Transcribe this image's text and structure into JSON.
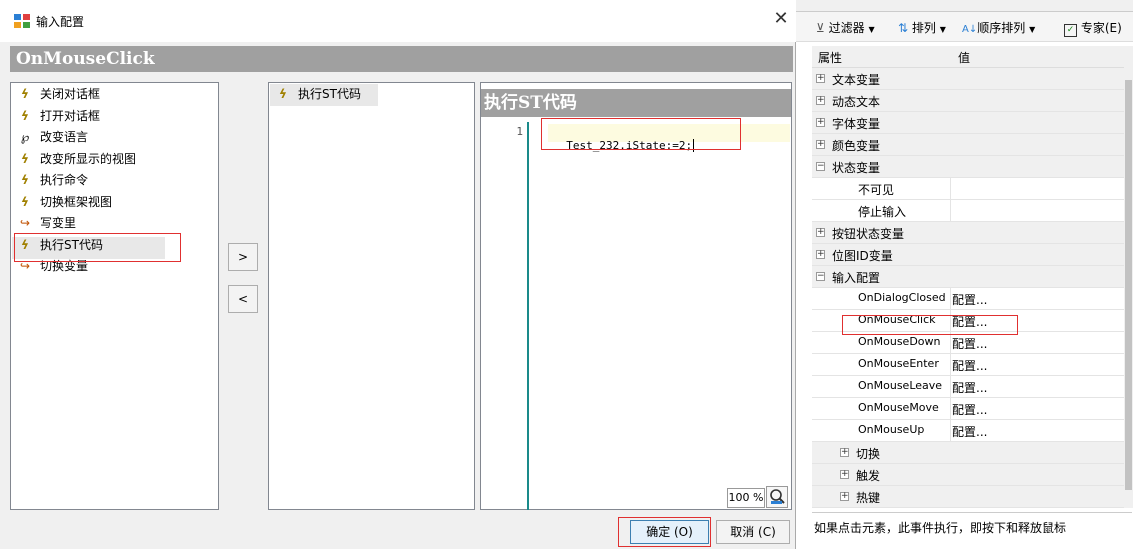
{
  "dialog": {
    "title": "输入配置",
    "close_glyph": "✕",
    "event_name": "OnMouseClick",
    "available_actions": [
      {
        "label": "关闭对话框",
        "icon": "bolt-icon"
      },
      {
        "label": "打开对话框",
        "icon": "bolt-icon"
      },
      {
        "label": "改变语言",
        "icon": "language-icon"
      },
      {
        "label": "改变所显示的视图",
        "icon": "bolt-icon"
      },
      {
        "label": "执行命令",
        "icon": "bolt-icon"
      },
      {
        "label": "切换框架视图",
        "icon": "bolt-icon"
      },
      {
        "label": "写变里",
        "icon": "write-variable-icon"
      },
      {
        "label": "执行ST代码",
        "icon": "bolt-icon"
      },
      {
        "label": "切换变量",
        "icon": "write-variable-icon"
      }
    ],
    "configured_actions": [
      {
        "label": "执行ST代码",
        "icon": "bolt-icon"
      }
    ],
    "add_button": ">",
    "remove_button": "<",
    "editor_title": "执行ST代码",
    "line_number": "1",
    "code": "Test_232.iState:=2;",
    "zoom": "100 %",
    "ok_button": "确定 (O)",
    "cancel_button": "取消 (C)"
  },
  "properties": {
    "toolbar": {
      "filter": "过滤器",
      "sort": "排列",
      "order": "顺序排列",
      "expert": "专家(E)"
    },
    "col_property": "属性",
    "col_value": "值",
    "rows": [
      {
        "name": "文本变量",
        "value": "",
        "kind": "cat",
        "exp": "+"
      },
      {
        "name": "动态文本",
        "value": "",
        "kind": "cat",
        "exp": "+"
      },
      {
        "name": "字体变量",
        "value": "",
        "kind": "cat",
        "exp": "+"
      },
      {
        "name": "颜色变量",
        "value": "",
        "kind": "cat",
        "exp": "+"
      },
      {
        "name": "状态变量",
        "value": "",
        "kind": "cat",
        "exp": "−"
      },
      {
        "name": "不可见",
        "value": "",
        "kind": "sub"
      },
      {
        "name": "停止输入",
        "value": "",
        "kind": "sub"
      },
      {
        "name": "按钮状态变量",
        "value": "",
        "kind": "cat",
        "exp": "+"
      },
      {
        "name": "位图ID变量",
        "value": "",
        "kind": "cat",
        "exp": "+"
      },
      {
        "name": "输入配置",
        "value": "",
        "kind": "cat",
        "exp": "−"
      },
      {
        "name": "OnDialogClosed",
        "value": "配置...",
        "kind": "event"
      },
      {
        "name": "OnMouseClick",
        "value": "配置...",
        "kind": "event"
      },
      {
        "name": "OnMouseDown",
        "value": "配置...",
        "kind": "event"
      },
      {
        "name": "OnMouseEnter",
        "value": "配置...",
        "kind": "event"
      },
      {
        "name": "OnMouseLeave",
        "value": "配置...",
        "kind": "event"
      },
      {
        "name": "OnMouseMove",
        "value": "配置...",
        "kind": "event"
      },
      {
        "name": "OnMouseUp",
        "value": "配置...",
        "kind": "event"
      },
      {
        "name": "切换",
        "value": "",
        "kind": "cat2",
        "exp": "+"
      },
      {
        "name": "触发",
        "value": "",
        "kind": "cat2",
        "exp": "+"
      },
      {
        "name": "热键",
        "value": "",
        "kind": "cat2",
        "exp": "+"
      }
    ],
    "description": "如果点击元素，此事件执行，即按下和释放鼠标"
  }
}
